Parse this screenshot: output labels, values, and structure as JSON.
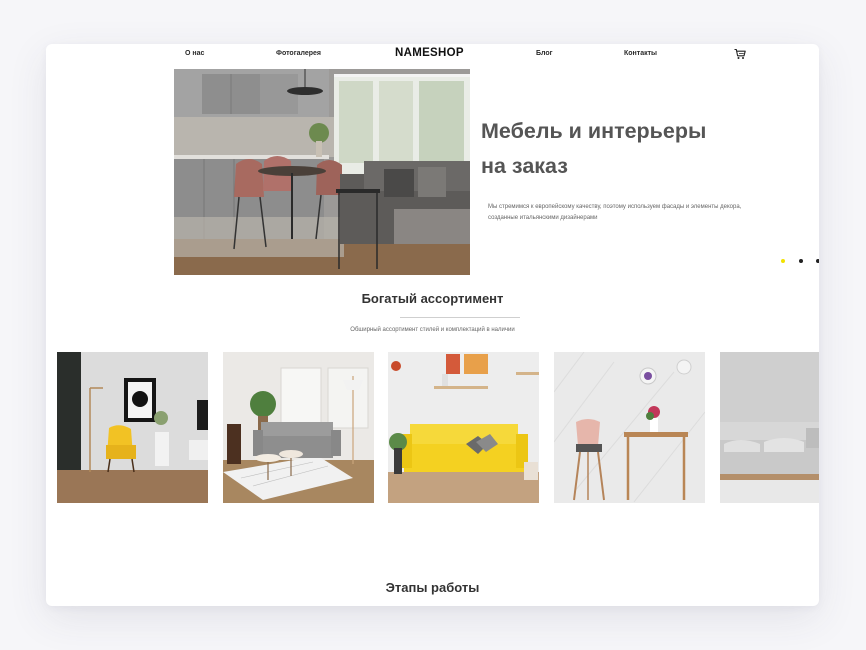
{
  "nav": {
    "about": "О нас",
    "gallery": "Фотогалерея",
    "logo": "NAMESHOP",
    "blog": "Блог",
    "contacts": "Контакты",
    "cart_icon": "cart-icon"
  },
  "hero": {
    "title_line1": "Мебель и интерьеры",
    "title_line2": "на заказ",
    "description": "Мы стремимся к европейскому качеству, поэтому используем фасады и элементы декора, созданные итальянскими дизайнерами",
    "active_slide_color": "#f2e200"
  },
  "assortment": {
    "title": "Богатый ассортимент",
    "subtitle": "Обширный ассортимент стилей и комплектаций в наличии"
  },
  "stages": {
    "title": "Этапы работы"
  },
  "colors": {
    "accent": "#f2d51c",
    "text_dark": "#333333",
    "title_gray": "#555555"
  }
}
